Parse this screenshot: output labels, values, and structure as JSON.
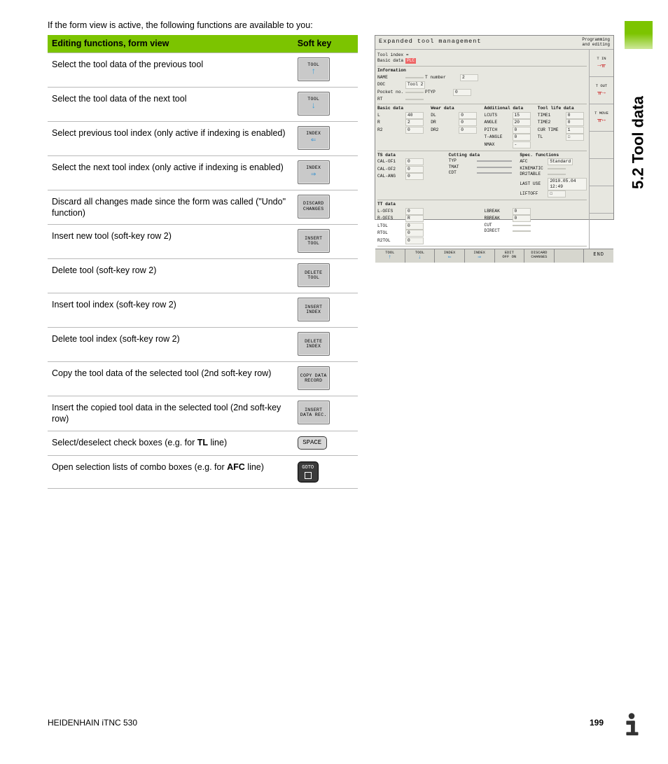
{
  "sidetab": "5.2 Tool data",
  "intro": "If the form view is active, the following functions are available to you:",
  "table": {
    "head": {
      "c1": "Editing functions, form view",
      "c2": "Soft key"
    },
    "rows": [
      {
        "desc": "Select the tool data of the previous tool",
        "key": {
          "type": "soft",
          "l1": "TOOL",
          "arrow": "↑",
          "arrowColor": "#3aa0d8"
        }
      },
      {
        "desc": "Select the tool data of the next tool",
        "key": {
          "type": "soft",
          "l1": "TOOL",
          "arrow": "↓",
          "arrowColor": "#3aa0d8"
        }
      },
      {
        "desc": "Select previous tool index (only active if indexing is enabled)",
        "key": {
          "type": "soft",
          "l1": "INDEX",
          "arrow": "⇐",
          "arrowColor": "#2f8ed0"
        }
      },
      {
        "desc": "Select the next tool index (only active if indexing is enabled)",
        "key": {
          "type": "soft",
          "l1": "INDEX",
          "arrow": "⇒",
          "arrowColor": "#2f8ed0"
        }
      },
      {
        "desc": "Discard all changes made since the form was called (\"Undo\" function)",
        "key": {
          "type": "soft",
          "l1": "DISCARD",
          "l2": "CHANGES"
        }
      },
      {
        "desc": "Insert new tool (soft-key row 2)",
        "key": {
          "type": "soft",
          "l1": "INSERT",
          "l2": "TOOL"
        }
      },
      {
        "desc": "Delete tool (soft-key row 2)",
        "key": {
          "type": "soft",
          "l1": "DELETE",
          "l2": "TOOL"
        }
      },
      {
        "desc": "Insert tool index (soft-key row 2)",
        "key": {
          "type": "soft",
          "l1": "INSERT",
          "l2": "INDEX"
        }
      },
      {
        "desc": "Delete tool index (soft-key row 2)",
        "key": {
          "type": "soft",
          "l1": "DELETE",
          "l2": "INDEX"
        }
      },
      {
        "desc": "Copy the tool data of the selected tool (2nd soft-key row)",
        "key": {
          "type": "soft",
          "l1": "COPY DATA",
          "l2": "RECORD"
        }
      },
      {
        "desc": "Insert the copied tool data in the selected tool (2nd soft-key row)",
        "key": {
          "type": "soft",
          "l1": "INSERT",
          "l2": "DATA REC."
        }
      },
      {
        "descHtml": "Select/deselect check boxes (e.g. for <b>TL</b> line)",
        "key": {
          "type": "keycap",
          "label": "SPACE"
        }
      },
      {
        "descHtml": "Open selection lists of combo boxes (e.g. for <b>AFC</b> line)",
        "key": {
          "type": "goto",
          "label": "GOTO"
        }
      }
    ]
  },
  "footer": {
    "left": "HEIDENHAIN iTNC 530",
    "page": "199"
  },
  "shot": {
    "title": "Expanded tool management",
    "mode1": "Programming",
    "mode2": "and editing",
    "sidebtns": [
      {
        "lbl": "T IN",
        "ic": "→ᚂ"
      },
      {
        "lbl": "T OUT",
        "ic": "ᚂ→"
      },
      {
        "lbl": "T MOVE",
        "ic": "ᚂ↔"
      }
    ],
    "clusters": {
      "c1": {
        "a": "Tool index =",
        "b": "Basic data",
        "bbadge": "PLC"
      },
      "info": {
        "hdr": "Information",
        "name": "NAME",
        "nameVal": "",
        "tnum": "T number",
        "tnumVal": "2",
        "doc": "DOC",
        "docVal": "Tool 2",
        "pocket": "Pocket no.",
        "ptyp": "PTYP",
        "ptypVal": "0",
        "rt": "RT"
      },
      "basic": {
        "hdr": "Basic data",
        "L": "L",
        "Lv": "40",
        "R": "R",
        "Rv": "2",
        "R2": "R2",
        "R2v": "0"
      },
      "wear": {
        "hdr": "Wear data",
        "DL": "DL",
        "DLv": "0",
        "DR": "DR",
        "DRv": "0",
        "DR2": "DR2",
        "DR2v": "0"
      },
      "addl": {
        "hdr": "Additional data",
        "LCUTS": "LCUTS",
        "LCUTSv": "15",
        "ANGLE": "ANGLE",
        "ANGLEv": "20",
        "PITCH": "PITCH",
        "PITCHv": "0",
        "TANGLE": "T-ANGLE",
        "TANGLEv": "0",
        "NMAX": "NMAX",
        "NMAXv": "-"
      },
      "life": {
        "hdr": "Tool life data",
        "T1": "TIME1",
        "T1v": "0",
        "T2": "TIME2",
        "T2v": "0",
        "CT": "CUR TIME",
        "CTv": "1",
        "TL": "TL"
      },
      "ts": {
        "hdr": "TS data",
        "a": "CAL-OF1",
        "av": "0",
        "b": "CAL-OF2",
        "bv": "0",
        "c": "CAL-ANG",
        "cv": "0"
      },
      "cut": {
        "hdr": "Cutting data",
        "typ": "TYP",
        "tmat": "TMAT",
        "cdt": "CDT"
      },
      "spec": {
        "hdr": "Spec. functions",
        "afc": "AFC",
        "afcv": "Standard",
        "kin": "KINEMATIC",
        "dr2": "DR2TABLE",
        "last": "LAST USE",
        "lastv": "2010.05.04 12:49",
        "lift": "LIFTOFF"
      },
      "tt": {
        "hdr": "TT data",
        "a": "L-OFFS",
        "av": "0",
        "b": "R-OFFS",
        "bv": "R",
        "c": "LTOL",
        "cv": "0",
        "d": "RTOL",
        "dv": "0",
        "e": "R2TOL",
        "ev": "0",
        "lb": "LBREAK",
        "lbv": "0",
        "rb": "RBREAK",
        "rbv": "0",
        "cut": "CUT",
        "dir": "DIRECT"
      }
    },
    "softkeys": [
      {
        "l1": "TOOL",
        "arrow": "↑"
      },
      {
        "l1": "TOOL",
        "arrow": "↓"
      },
      {
        "l1": "INDEX",
        "arrow": "⇐"
      },
      {
        "l1": "INDEX",
        "arrow": "⇒"
      },
      {
        "l1": "EDIT",
        "l2": "OFF  ON"
      },
      {
        "l1": "DISCARD",
        "l2": "CHANGES"
      },
      {
        "l1": "",
        "l2": ""
      },
      {
        "end": "END"
      }
    ]
  }
}
